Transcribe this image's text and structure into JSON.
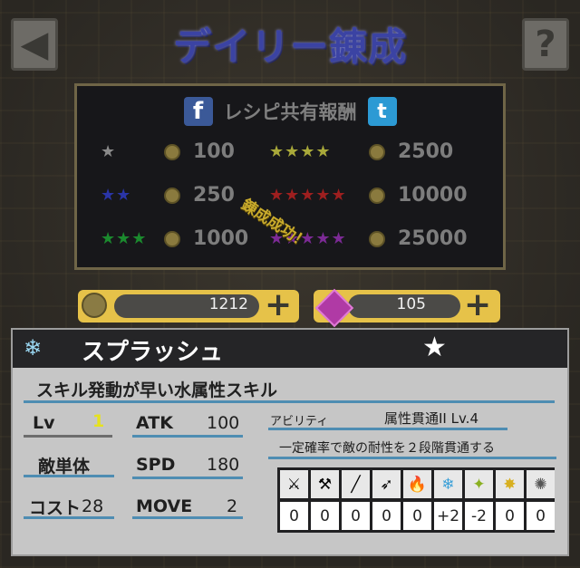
{
  "header": {
    "title": "デイリー錬成",
    "back_glyph": "◀",
    "help_glyph": "?"
  },
  "reward": {
    "share_label": "レシピ共有報酬",
    "facebook_glyph": "f",
    "twitter_glyph": "t",
    "rows": [
      {
        "stars": "★",
        "star_color": "#8a8a8a",
        "amount": "100"
      },
      {
        "stars": "★★★★",
        "star_color": "#a9a93a",
        "amount": "2500"
      },
      {
        "stars": "★★",
        "star_color": "#2a35a8",
        "amount": "250"
      },
      {
        "stars": "★★★★★",
        "star_color": "#9e1f1f",
        "amount": "10000"
      },
      {
        "stars": "★★★",
        "star_color": "#1b8a2e",
        "amount": "1000"
      },
      {
        "stars": "★★★★★",
        "star_color": "#7c2a95",
        "amount": "25000"
      }
    ]
  },
  "toast": "錬成成功！",
  "currency": {
    "gold": "1212",
    "gems": "105",
    "plus_glyph": "+"
  },
  "skill": {
    "name": "スプラッシュ",
    "rarity": "★",
    "description": "スキル発動が早い水属性スキル",
    "lv_label": "Lv",
    "lv": "1",
    "target": "敵単体",
    "cost_label": "コスト",
    "cost": "28",
    "atk_label": "ATK",
    "atk": "100",
    "spd_label": "SPD",
    "spd": "180",
    "move_label": "MOVE",
    "move": "2",
    "ability_label": "アビリティ",
    "ability_name": "属性貫通II Lv.4",
    "ability_desc": "一定確率で敵の耐性を２段階貫通する",
    "elements": [
      {
        "icon": "sword-icon",
        "glyph": "⚔",
        "value": "0"
      },
      {
        "icon": "hammer-icon",
        "glyph": "⚒",
        "value": "0"
      },
      {
        "icon": "staff-icon",
        "glyph": "╱",
        "value": "0"
      },
      {
        "icon": "bow-icon",
        "glyph": "➶",
        "value": "0"
      },
      {
        "icon": "fire-icon",
        "glyph": "🔥",
        "value": "0"
      },
      {
        "icon": "water-icon",
        "glyph": "❄",
        "value": "+2"
      },
      {
        "icon": "wind-icon",
        "glyph": "✦",
        "value": "-2"
      },
      {
        "icon": "light-icon",
        "glyph": "✸",
        "value": "0"
      },
      {
        "icon": "dark-icon",
        "glyph": "✺",
        "value": "0"
      }
    ]
  }
}
